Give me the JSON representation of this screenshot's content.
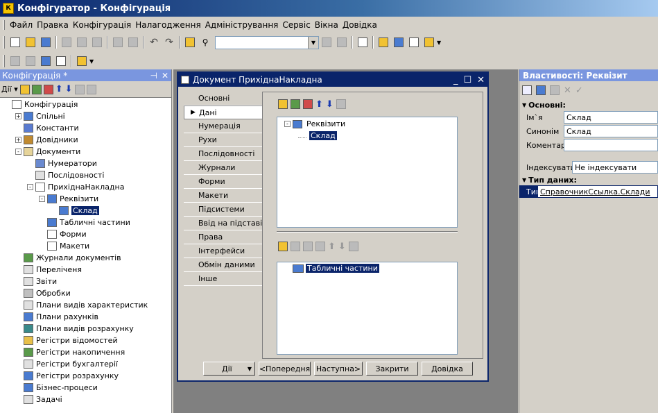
{
  "app": {
    "title": "Конфігуратор - Конфігурація"
  },
  "menu": [
    "Файл",
    "Правка",
    "Конфігурація",
    "Налагодження",
    "Адміністрування",
    "Сервіс",
    "Вікна",
    "Довідка"
  ],
  "left_panel": {
    "title": "Конфігурація *",
    "actions_label": "Дії",
    "tree": [
      {
        "label": "Конфігурація",
        "depth": 0,
        "expander": "",
        "icon": "config-icon",
        "color": "#ffffff"
      },
      {
        "label": "Спільні",
        "depth": 1,
        "expander": "+",
        "icon": "common-icon",
        "color": "#4a7bd0"
      },
      {
        "label": "Константи",
        "depth": 1,
        "expander": "",
        "icon": "constants-icon",
        "color": "#5a7bd0"
      },
      {
        "label": "Довідники",
        "depth": 1,
        "expander": "+",
        "icon": "catalogs-icon",
        "color": "#c08a30"
      },
      {
        "label": "Документи",
        "depth": 1,
        "expander": "-",
        "icon": "documents-icon",
        "color": "#e6d49a"
      },
      {
        "label": "Нумератори",
        "depth": 2,
        "expander": "",
        "icon": "numerators-icon",
        "color": "#6a8ad0"
      },
      {
        "label": "Послідовності",
        "depth": 2,
        "expander": "",
        "icon": "sequences-icon",
        "color": "#e0e0e0"
      },
      {
        "label": "ПрихіднаНакладна",
        "depth": 2,
        "expander": "-",
        "icon": "document-icon",
        "color": "#ffffff"
      },
      {
        "label": "Реквізити",
        "depth": 3,
        "expander": "-",
        "icon": "attributes-icon",
        "color": "#4a7bd0"
      },
      {
        "label": "Склад",
        "depth": 4,
        "expander": "",
        "icon": "attribute-icon",
        "color": "#4a7bd0",
        "selected": true
      },
      {
        "label": "Табличні частини",
        "depth": 3,
        "expander": "",
        "icon": "tabular-icon",
        "color": "#4a7bd0"
      },
      {
        "label": "Форми",
        "depth": 3,
        "expander": "",
        "icon": "forms-icon",
        "color": "#ffffff"
      },
      {
        "label": "Макети",
        "depth": 3,
        "expander": "",
        "icon": "templates-icon",
        "color": "#ffffff"
      },
      {
        "label": "Журнали документів",
        "depth": 1,
        "expander": "",
        "icon": "journals-icon",
        "color": "#5a9a4a"
      },
      {
        "label": "Переліченя",
        "depth": 1,
        "expander": "",
        "icon": "enums-icon",
        "color": "#e0e0e0"
      },
      {
        "label": "Звіти",
        "depth": 1,
        "expander": "",
        "icon": "reports-icon",
        "color": "#e0e0e0"
      },
      {
        "label": "Обробки",
        "depth": 1,
        "expander": "",
        "icon": "processing-icon",
        "color": "#c0c0c0"
      },
      {
        "label": "Плани видів характеристик",
        "depth": 1,
        "expander": "",
        "icon": "charts-char-icon",
        "color": "#e0e0e0"
      },
      {
        "label": "Плани рахунків",
        "depth": 1,
        "expander": "",
        "icon": "accounts-icon",
        "color": "#4a7bd0"
      },
      {
        "label": "Плани видів розрахунку",
        "depth": 1,
        "expander": "",
        "icon": "calc-types-icon",
        "color": "#3a8a8a"
      },
      {
        "label": "Регістри відомостей",
        "depth": 1,
        "expander": "",
        "icon": "info-registers-icon",
        "color": "#e8c04a"
      },
      {
        "label": "Регістри накопичення",
        "depth": 1,
        "expander": "",
        "icon": "accum-registers-icon",
        "color": "#5a9a4a"
      },
      {
        "label": "Регістри бухгалтерії",
        "depth": 1,
        "expander": "",
        "icon": "acc-registers-icon",
        "color": "#e0e0e0"
      },
      {
        "label": "Регістри розрахунку",
        "depth": 1,
        "expander": "",
        "icon": "calc-registers-icon",
        "color": "#4a7bd0"
      },
      {
        "label": "Бізнес-процеси",
        "depth": 1,
        "expander": "",
        "icon": "business-process-icon",
        "color": "#4a7bd0"
      },
      {
        "label": "Задачі",
        "depth": 1,
        "expander": "",
        "icon": "tasks-icon",
        "color": "#e0e0e0"
      }
    ]
  },
  "doc_window": {
    "title": "Документ ПрихіднаНакладна",
    "tabs": [
      "Основні",
      "Дані",
      "Нумерація",
      "Рухи",
      "Послідовності",
      "Журнали",
      "Форми",
      "Макети",
      "Підсистеми",
      "Ввід на підставі",
      "Права",
      "Інтерфейси",
      "Обмін даними",
      "Інше"
    ],
    "active_tab": 1,
    "attributes_root": "Реквізити",
    "attribute_selected": "Склад",
    "tabular_root": "Табличні частини",
    "buttons": {
      "actions": "Дії",
      "prev": "<Попередня",
      "next": "Наступна>",
      "close": "Закрити",
      "help": "Довідка"
    }
  },
  "right_panel": {
    "title": "Властивості: Реквізит",
    "section_main": "Основні:",
    "name_label": "Ім`я",
    "name_value": "Склад",
    "synonym_label": "Синонім",
    "synonym_value": "Склад",
    "comment_label": "Коментар",
    "comment_value": "",
    "index_label": "Індексувати",
    "index_value": "Не індексувати",
    "section_type": "Тип даних:",
    "type_label": "Тип",
    "type_value": "СправочникСсылка.Склади"
  }
}
